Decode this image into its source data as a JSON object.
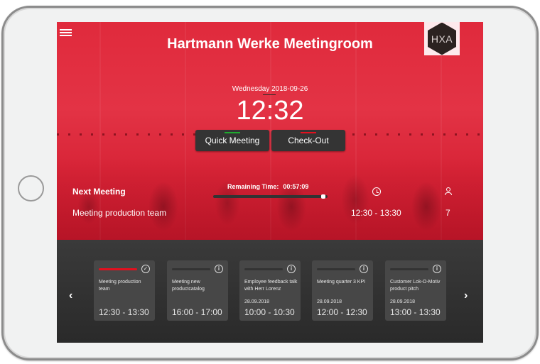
{
  "header": {
    "title": "Hartmann Werke Meetingroom",
    "logo_text": "HXA",
    "menu_icon": "hamburger-menu-icon"
  },
  "datetime": {
    "date": "Wednesday 2018-09-26",
    "time": "12:32"
  },
  "actions": {
    "quick_meeting": {
      "label": "Quick Meeting",
      "indicator_color": "#1faa2f"
    },
    "check_out": {
      "label": "Check-Out",
      "indicator_color": "#e3101e"
    }
  },
  "next_meeting": {
    "heading": "Next Meeting",
    "remaining_label": "Remaining Time:",
    "remaining_value": "00:57:09",
    "progress_percent": 98,
    "name": "Meeting production team",
    "time": "12:30 - 13:30",
    "attendees": "7",
    "time_icon": "clock-icon",
    "attendees_icon": "person-icon"
  },
  "carousel": {
    "prev_icon": "chevron-left-icon",
    "next_icon": "chevron-right-icon",
    "prev_glyph": "‹",
    "next_glyph": "›",
    "cards": [
      {
        "title": "Meeting production team",
        "date": "",
        "time": "12:30 - 13:30",
        "status": "active",
        "icon": "check-circle-icon",
        "icon_glyph": "✓"
      },
      {
        "title": "Meeting new productcatalog",
        "date": "",
        "time": "16:00 - 17:00",
        "status": "upcoming",
        "icon": "info-circle-icon",
        "icon_glyph": "i"
      },
      {
        "title": "Employee feedback talk with Herr Lorenz",
        "date": "28.09.2018",
        "time": "10:00 - 10:30",
        "status": "upcoming",
        "icon": "info-circle-icon",
        "icon_glyph": "i"
      },
      {
        "title": "Meeting quarter 3 KPI",
        "date": "28.09.2018",
        "time": "12:00 - 12:30",
        "status": "upcoming",
        "icon": "info-circle-icon",
        "icon_glyph": "i"
      },
      {
        "title": "Customer Lok-O-Motiv product pitch",
        "date": "28.09.2018",
        "time": "13:00 - 13:30",
        "status": "upcoming",
        "icon": "info-circle-icon",
        "icon_glyph": "i"
      }
    ]
  }
}
